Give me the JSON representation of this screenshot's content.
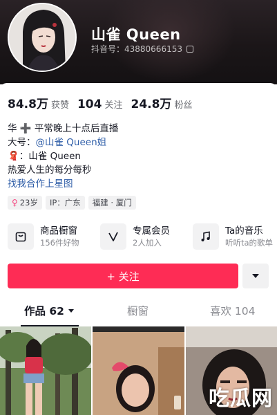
{
  "profile": {
    "nickname": "山雀 Queen",
    "douyin_id": "抖音号：43880666153"
  },
  "stats": [
    {
      "value": "84.8万",
      "label": "获赞"
    },
    {
      "value": "104",
      "label": "关注"
    },
    {
      "value": "24.8万",
      "label": "粉丝"
    }
  ],
  "bio": {
    "line1": "华 ➕ 平常晚上十点后直播",
    "line2_prefix": "大号：",
    "line2_mention": "@山雀 Queen姐",
    "line3": "🧣：山雀 Queen",
    "line4": "热爱人生的每分每秒",
    "line5": "找我合作上星图"
  },
  "tags": {
    "age": "23岁",
    "ip": "IP：广东",
    "location": "福建 · 厦门"
  },
  "shortcuts": [
    {
      "title": "商品橱窗",
      "subtitle": "156件好物",
      "icon": "shopping-bag-icon"
    },
    {
      "title": "专属会员",
      "subtitle": "2人加入",
      "icon": "v-membership-icon"
    },
    {
      "title": "Ta的音乐",
      "subtitle": "听听ta的歌单",
      "icon": "music-note-icon"
    }
  ],
  "actions": {
    "follow_label": "+ 关注"
  },
  "tabs": {
    "works": "作品 62",
    "showcase": "橱窗",
    "likes": "喜欢 104"
  },
  "watermark": "吃瓜网",
  "colors": {
    "accent": "#fe2c55",
    "link": "#2f5ea8",
    "header_bg": "#1b1618"
  }
}
